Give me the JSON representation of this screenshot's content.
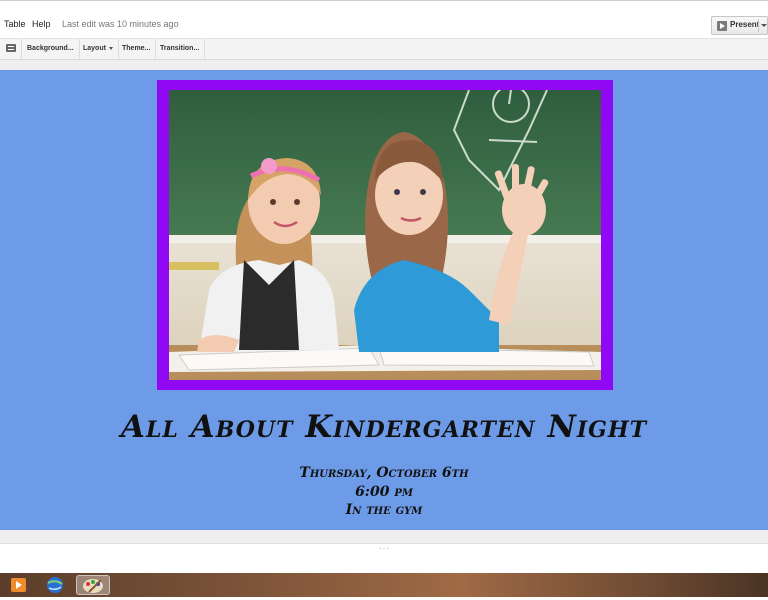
{
  "menubar": {
    "items": [
      "Table",
      "Help"
    ],
    "last_edit": "Last edit was 10 minutes ago"
  },
  "present": {
    "label": "Present"
  },
  "toolbar": {
    "background_label": "Background...",
    "layout_label": "Layout",
    "theme_label": "Theme...",
    "transition_label": "Transition..."
  },
  "slide": {
    "title": "All About Kindergarten Night",
    "details": [
      "Thursday, October 6th",
      "6:00 pm",
      "In the gym"
    ]
  },
  "taskbar": {
    "icons": [
      "media-player-icon",
      "google-earth-icon",
      "paint-icon"
    ]
  },
  "colors": {
    "slide_background": "#6e9be8",
    "photo_frame": "#9108f4",
    "title_text": "#111111"
  }
}
